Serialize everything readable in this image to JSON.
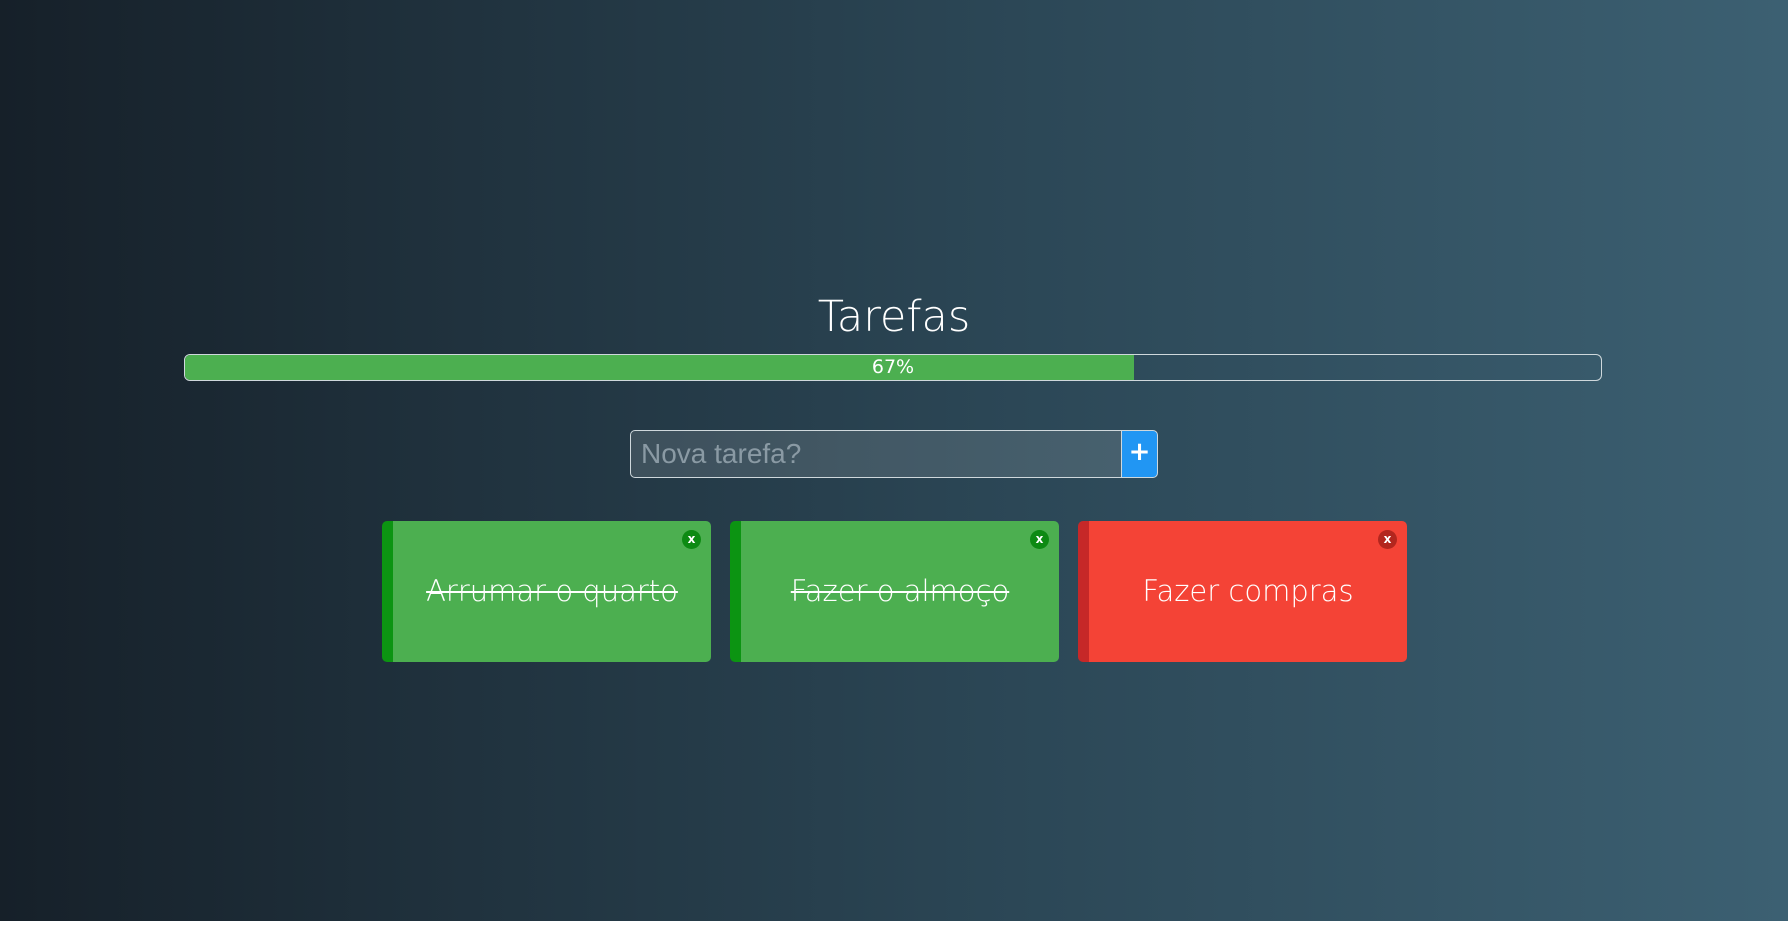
{
  "page": {
    "title": "Tarefas"
  },
  "progress": {
    "percent": 67,
    "label": "67%"
  },
  "new_task": {
    "placeholder": "Nova tarefa?",
    "add_label": "+"
  },
  "tasks": [
    {
      "label": "Arrumar o quarto",
      "done": true,
      "close_label": "x"
    },
    {
      "label": "Fazer o almoço",
      "done": true,
      "close_label": "x"
    },
    {
      "label": "Fazer compras",
      "done": false,
      "close_label": "x"
    }
  ],
  "colors": {
    "done": "#4caf50",
    "pending": "#f44336",
    "accent": "#2196f3"
  }
}
